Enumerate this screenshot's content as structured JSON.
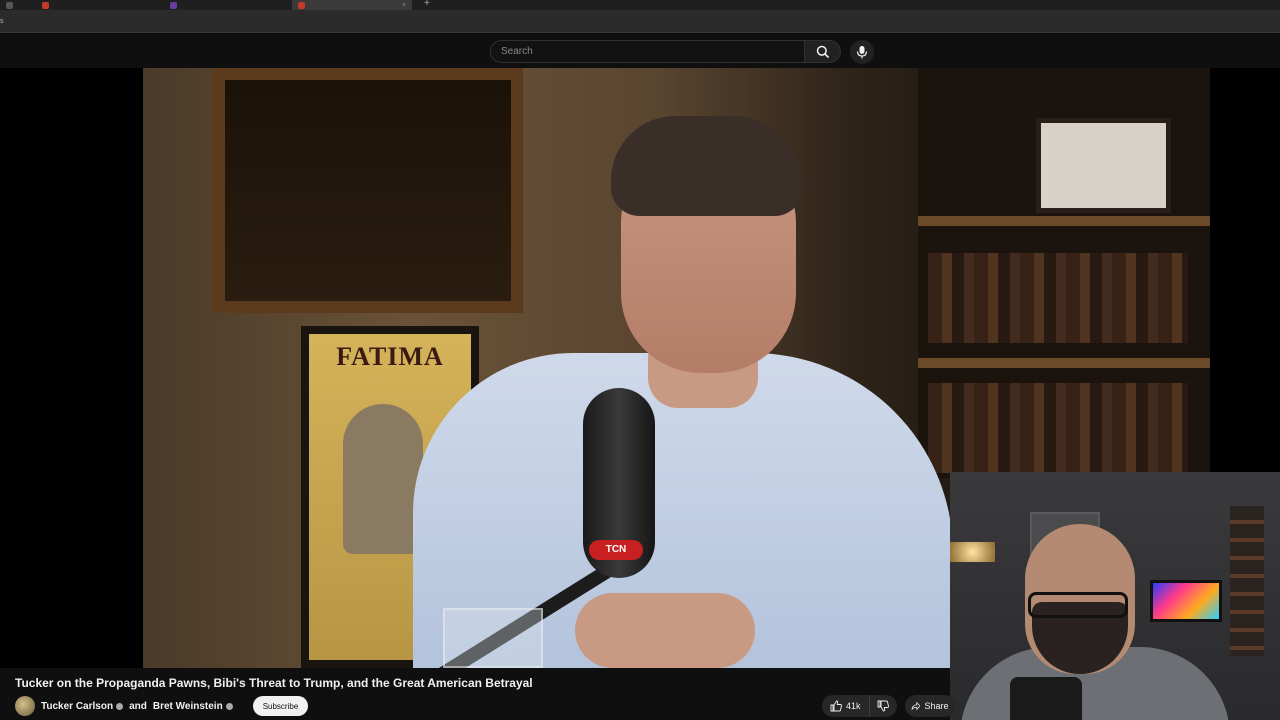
{
  "browser": {
    "left_mark": "s",
    "new_tab_glyph": "+"
  },
  "masthead": {
    "search_placeholder": "Search"
  },
  "video": {
    "poster_text": "FATIMA",
    "mic_badge": "TCN"
  },
  "details": {
    "title": "Tucker on the Propaganda Pawns, Bibi's Threat to Trump, and the Great American Betrayal",
    "channel_1": "Tucker Carlson",
    "and_text": "and",
    "channel_2": "Bret Weinstein",
    "subscribe_label": "Subscribe",
    "like_count": "41k",
    "share_label": "Share"
  },
  "icons": {
    "search": "search-icon",
    "mic": "microphone-icon",
    "like": "thumbs-up-icon",
    "dislike": "thumbs-down-icon",
    "share": "share-arrow-icon",
    "verified": "verified-badge-icon"
  },
  "colors": {
    "background": "#0f0f0f",
    "subscribe_bg": "#f1f1f1",
    "pill_bg": "#272727"
  }
}
